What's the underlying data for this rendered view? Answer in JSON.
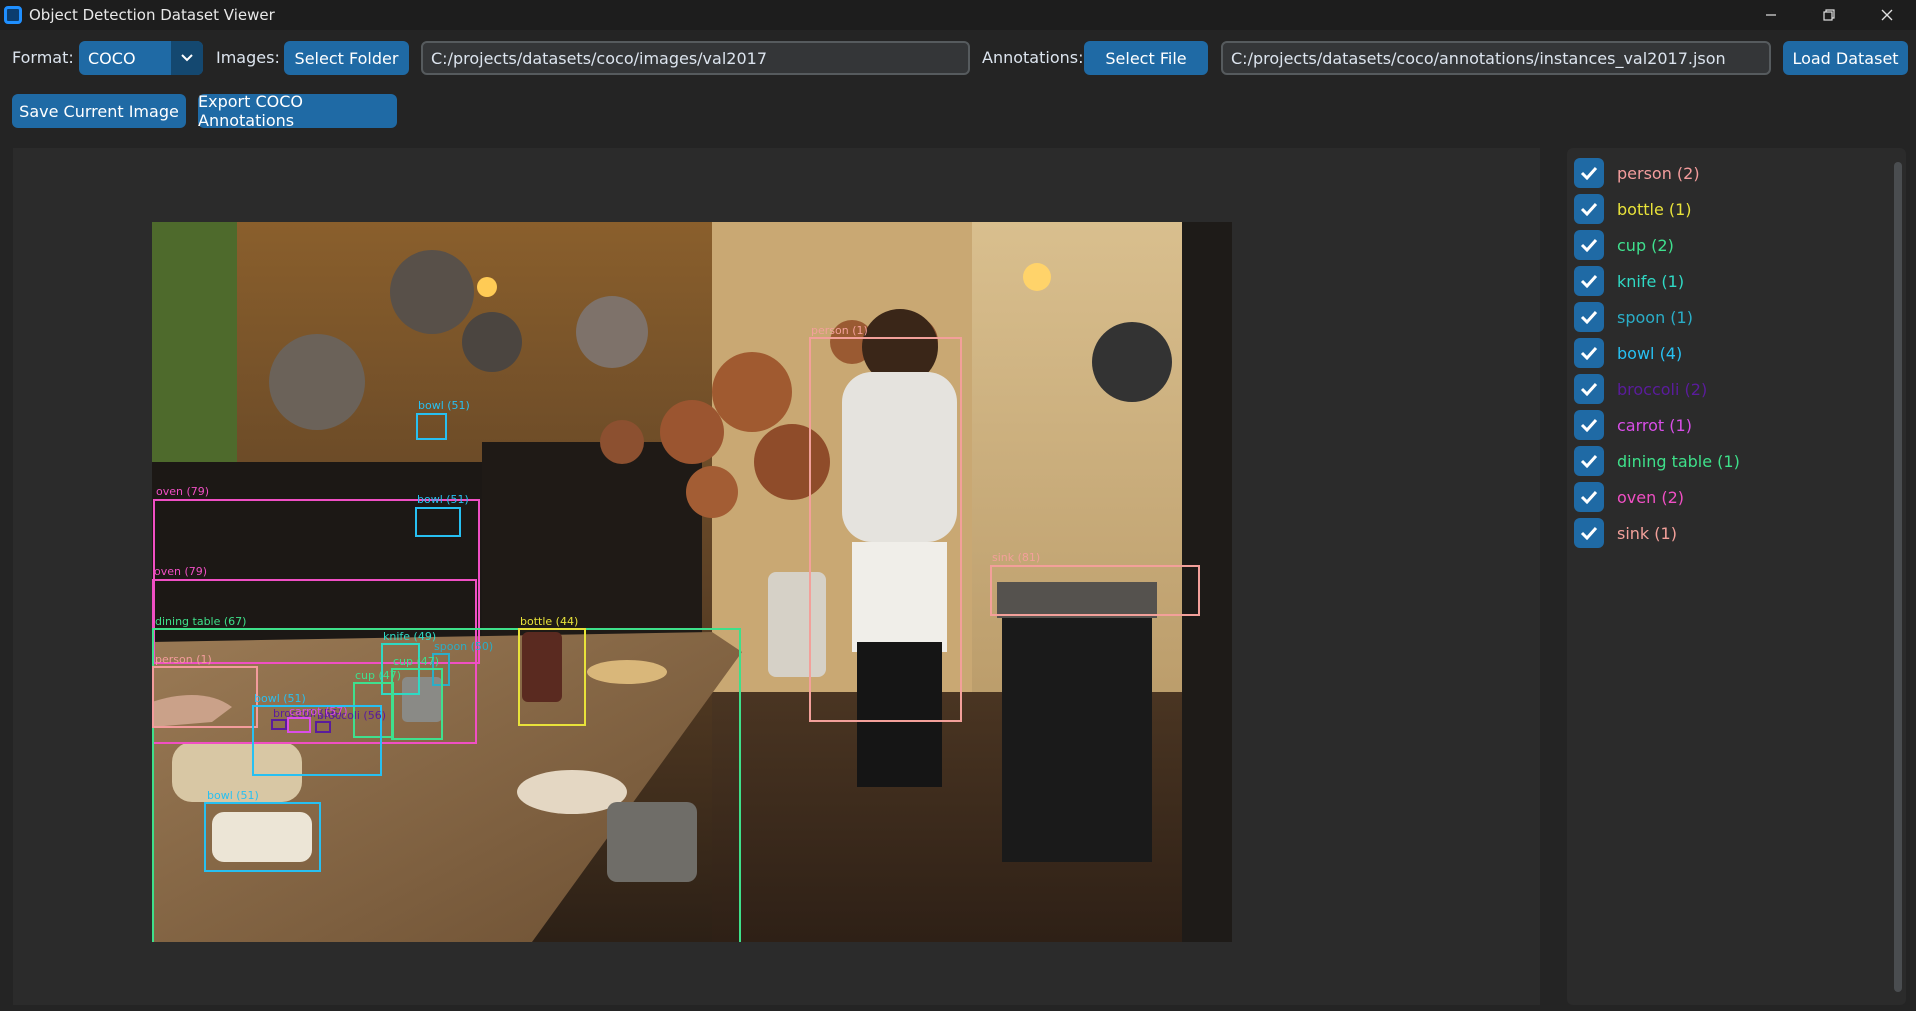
{
  "window": {
    "title": "Object Detection Dataset Viewer",
    "controls": [
      "—",
      "❐",
      "✕"
    ]
  },
  "toolbar": {
    "format_label": "Format:",
    "format_value": "COCO",
    "images_label": "Images:",
    "select_folder": "Select Folder",
    "images_path": "C:/projects/datasets/coco/images/val2017",
    "annotations_label": "Annotations:",
    "select_file": "Select File",
    "annotations_path": "C:/projects/datasets/coco/annotations/instances_val2017.json",
    "load_dataset": "Load Dataset",
    "save_image": "Save Current Image",
    "export_coco": "Export COCO Annotations"
  },
  "classes": [
    {
      "label": "person (2)",
      "color": "#f39c9c",
      "checked": true
    },
    {
      "label": "bottle (1)",
      "color": "#e8e23a",
      "checked": true
    },
    {
      "label": "cup (2)",
      "color": "#3fe08e",
      "checked": true
    },
    {
      "label": "knife (1)",
      "color": "#2fd9c4",
      "checked": true
    },
    {
      "label": "spoon (1)",
      "color": "#2aaec8",
      "checked": true
    },
    {
      "label": "bowl (4)",
      "color": "#27c0f2",
      "checked": true
    },
    {
      "label": "broccoli (2)",
      "color": "#5a1c9c",
      "checked": true
    },
    {
      "label": "carrot (1)",
      "color": "#d94ee8",
      "checked": true
    },
    {
      "label": "dining table (1)",
      "color": "#3ee08a",
      "checked": true
    },
    {
      "label": "oven (2)",
      "color": "#f04fc4",
      "checked": true
    },
    {
      "label": "sink (1)",
      "color": "#f3a09a",
      "checked": true
    }
  ],
  "annotations": [
    {
      "label": "person (1)",
      "color": "#f3a09a"
    },
    {
      "label": "bowl (51)",
      "color": "#27c0f2"
    },
    {
      "label": "oven (79)",
      "color": "#f04fc4"
    },
    {
      "label": "bowl (51)",
      "color": "#27c0f2"
    },
    {
      "label": "oven (79)",
      "color": "#f04fc4"
    },
    {
      "label": "sink (81)",
      "color": "#f3a09a"
    },
    {
      "label": "dining table (67)",
      "color": "#3ee08a"
    },
    {
      "label": "bottle (44)",
      "color": "#e8e23a"
    },
    {
      "label": "knife (49)",
      "color": "#2fd9c4"
    },
    {
      "label": "spoon (50)",
      "color": "#2aaec8"
    },
    {
      "label": "person (1)",
      "color": "#f39c9c"
    },
    {
      "label": "cup (47)",
      "color": "#3fe08e"
    },
    {
      "label": "cup (47)",
      "color": "#3fe08e"
    },
    {
      "label": "bowl (51)",
      "color": "#27c0f2"
    },
    {
      "label": "bowl (51)",
      "color": "#27c0f2"
    },
    {
      "label": "broccoli (56)",
      "color": "#5a1c9c"
    },
    {
      "label": "broccoli (56)",
      "color": "#5a1c9c"
    },
    {
      "label": "carrot (57)",
      "color": "#d94ee8"
    }
  ]
}
